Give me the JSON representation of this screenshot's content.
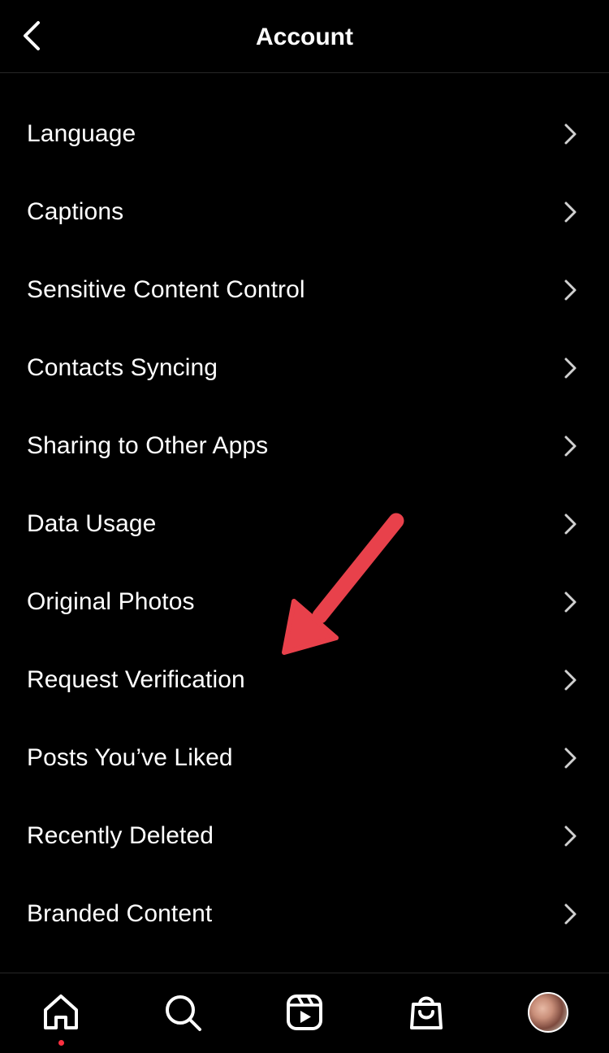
{
  "header": {
    "title": "Account",
    "back_icon": "chevron-left-icon"
  },
  "menu": {
    "items": [
      {
        "label": "Language"
      },
      {
        "label": "Captions"
      },
      {
        "label": "Sensitive Content Control"
      },
      {
        "label": "Contacts Syncing"
      },
      {
        "label": "Sharing to Other Apps"
      },
      {
        "label": "Data Usage"
      },
      {
        "label": "Original Photos"
      },
      {
        "label": "Request Verification"
      },
      {
        "label": "Posts You’ve Liked"
      },
      {
        "label": "Recently Deleted"
      },
      {
        "label": "Branded Content"
      }
    ],
    "item_icon": "chevron-right-icon"
  },
  "annotation": {
    "icon": "red-arrow-icon",
    "color": "#e8414b"
  },
  "tabbar": {
    "tabs": [
      {
        "icon": "home-icon",
        "active": true
      },
      {
        "icon": "search-icon"
      },
      {
        "icon": "reels-icon"
      },
      {
        "icon": "shop-icon"
      },
      {
        "icon": "profile-avatar"
      }
    ],
    "notification_dot_color": "#ff3040"
  },
  "colors": {
    "background": "#000000",
    "text": "#ffffff",
    "chevron": "#d0d0d0",
    "divider": "#262626"
  }
}
